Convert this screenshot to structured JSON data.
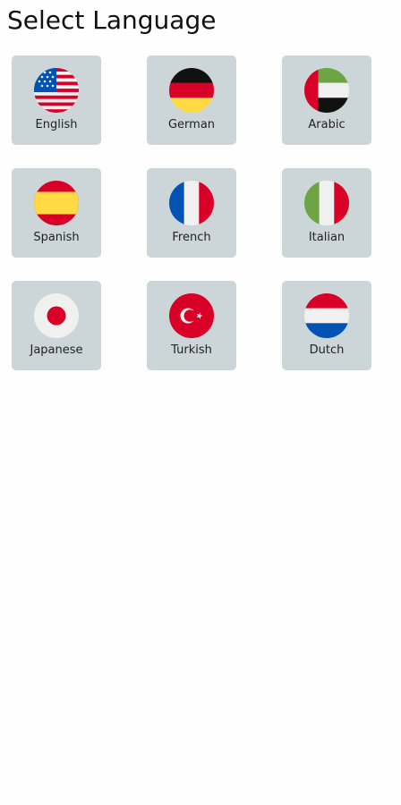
{
  "header": {
    "title": "Select Language"
  },
  "languages": [
    {
      "label": "English",
      "icon": "us-flag-icon"
    },
    {
      "label": "German",
      "icon": "germany-flag-icon"
    },
    {
      "label": "Arabic",
      "icon": "uae-flag-icon"
    },
    {
      "label": "Spanish",
      "icon": "spain-flag-icon"
    },
    {
      "label": "French",
      "icon": "france-flag-icon"
    },
    {
      "label": "Italian",
      "icon": "italy-flag-icon"
    },
    {
      "label": "Japanese",
      "icon": "japan-flag-icon"
    },
    {
      "label": "Turkish",
      "icon": "turkey-flag-icon"
    },
    {
      "label": "Dutch",
      "icon": "netherlands-flag-icon"
    }
  ],
  "colors": {
    "tile_background": "#ccd5d7",
    "page_background": "#fefefe"
  }
}
